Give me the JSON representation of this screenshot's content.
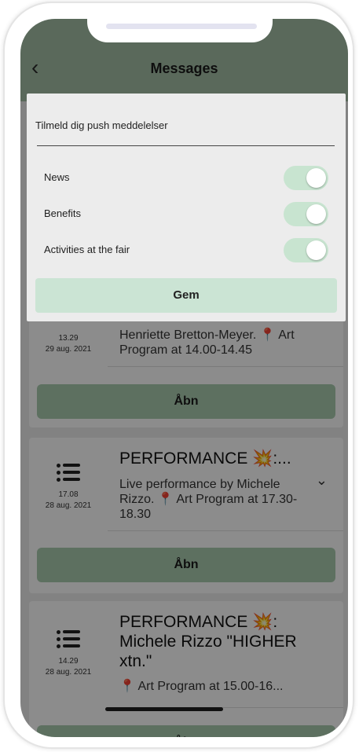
{
  "header": {
    "back_icon": "chevron-left-icon",
    "title": "Messages"
  },
  "dialog": {
    "title": "Tilmeld dig push meddelelser",
    "options": [
      {
        "label": "News",
        "enabled": true
      },
      {
        "label": "Benefits",
        "enabled": true
      },
      {
        "label": "Activities at the fair",
        "enabled": true
      }
    ],
    "save_label": "Gem"
  },
  "messages": [
    {
      "icon": "list-icon",
      "time": "13.29",
      "date": "29 aug. 2021",
      "title": "",
      "description": "Henriette Bretton-Meyer. 📍 Art Program at 14.00-14.45",
      "open_label": "Åbn"
    },
    {
      "icon": "list-icon",
      "time": "17.08",
      "date": "28 aug. 2021",
      "title": "PERFORMANCE 💥:...",
      "description": "Live performance by Michele Rizzo. 📍 Art Program at 17.30-18.30",
      "expand_icon": "chevron-down-icon",
      "open_label": "Åbn"
    },
    {
      "icon": "list-icon",
      "time": "14.29",
      "date": "28 aug. 2021",
      "title": "PERFORMANCE 💥: Michele Rizzo \"HIGHER xtn.\"",
      "description": "📍 Art Program at 15.00-16...",
      "open_label": "Åbn"
    }
  ],
  "colors": {
    "header_bg": "#a4bfa7",
    "button_bg": "#a9ccb0",
    "toggle_on": "#c8e4d0",
    "overlay": "rgba(0,0,0,0.45)"
  }
}
